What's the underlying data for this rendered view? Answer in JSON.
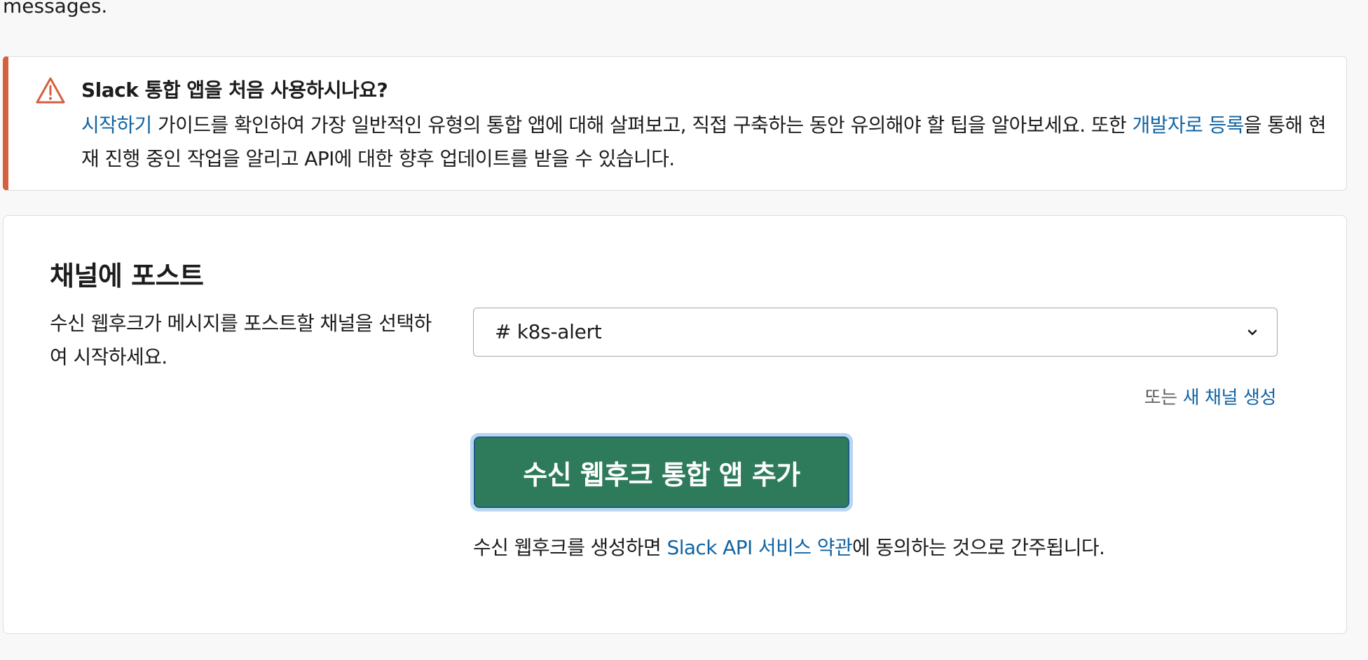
{
  "top_text": "messages.",
  "callout": {
    "icon": "warning-triangle-icon",
    "accent_color": "#d4603e",
    "title": "Slack 통합 앱을 처음 사용하시나요?",
    "body_link1": "시작하기",
    "body_text1": " 가이드를 확인하여 가장 일반적인 유형의 통합 앱에 대해 살펴보고, 직접 구축하는 동안 유의해야 할 팁을 알아보세요. 또한 ",
    "body_link2": "개발자로 등록",
    "body_text2": "을 통해 현재 진행 중인 작업을 알리고 API에 대한 향후 업데이트를 받을 수 있습니다."
  },
  "post_to_channel": {
    "title": "채널에 포스트",
    "description": "수신 웹후크가 메시지를 포스트할 채널을 선택하여 시작하세요.",
    "selected_channel": "# k8s-alert",
    "or_text": "또는 ",
    "create_channel_link": "새 채널 생성",
    "add_button_label": "수신 웹후크 통합 앱 추가",
    "button_color": "#2e7b5c",
    "terms_text1": "수신 웹후크를 생성하면 ",
    "terms_link": "Slack API 서비스 약관",
    "terms_text2": "에 동의하는 것으로 간주됩니다."
  }
}
